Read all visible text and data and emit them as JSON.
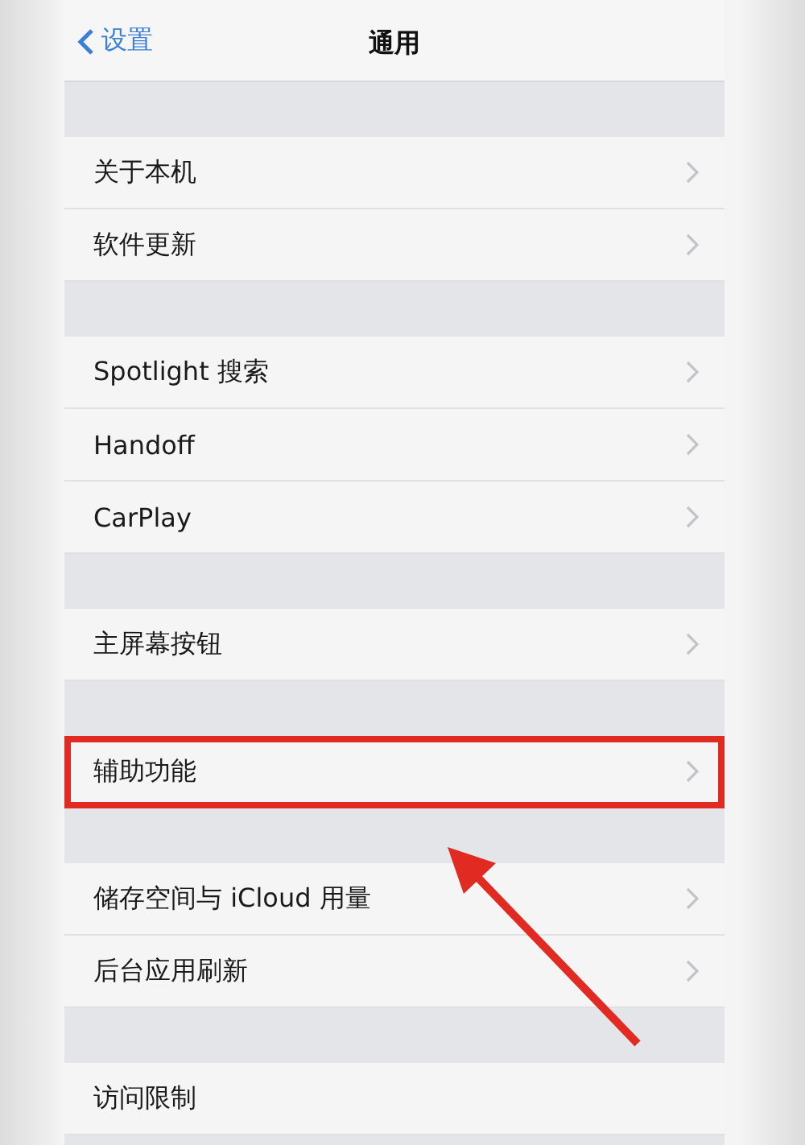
{
  "nav": {
    "back_label": "设置",
    "title": "通用"
  },
  "groups": [
    {
      "rows": [
        {
          "label": "关于本机",
          "highlighted": false,
          "chevron": true
        },
        {
          "label": "软件更新",
          "highlighted": false,
          "chevron": true
        }
      ]
    },
    {
      "rows": [
        {
          "label": "Spotlight 搜索",
          "highlighted": false,
          "chevron": true
        },
        {
          "label": "Handoff",
          "highlighted": false,
          "chevron": true
        },
        {
          "label": "CarPlay",
          "highlighted": false,
          "chevron": true
        }
      ]
    },
    {
      "rows": [
        {
          "label": "主屏幕按钮",
          "highlighted": false,
          "chevron": true
        }
      ]
    },
    {
      "rows": [
        {
          "label": "辅助功能",
          "highlighted": true,
          "chevron": true
        }
      ]
    },
    {
      "rows": [
        {
          "label": "储存空间与 iCloud 用量",
          "highlighted": false,
          "chevron": true
        },
        {
          "label": "后台应用刷新",
          "highlighted": false,
          "chevron": true
        }
      ]
    },
    {
      "rows": [
        {
          "label": "访问限制",
          "highlighted": false,
          "chevron": false
        }
      ]
    }
  ]
}
